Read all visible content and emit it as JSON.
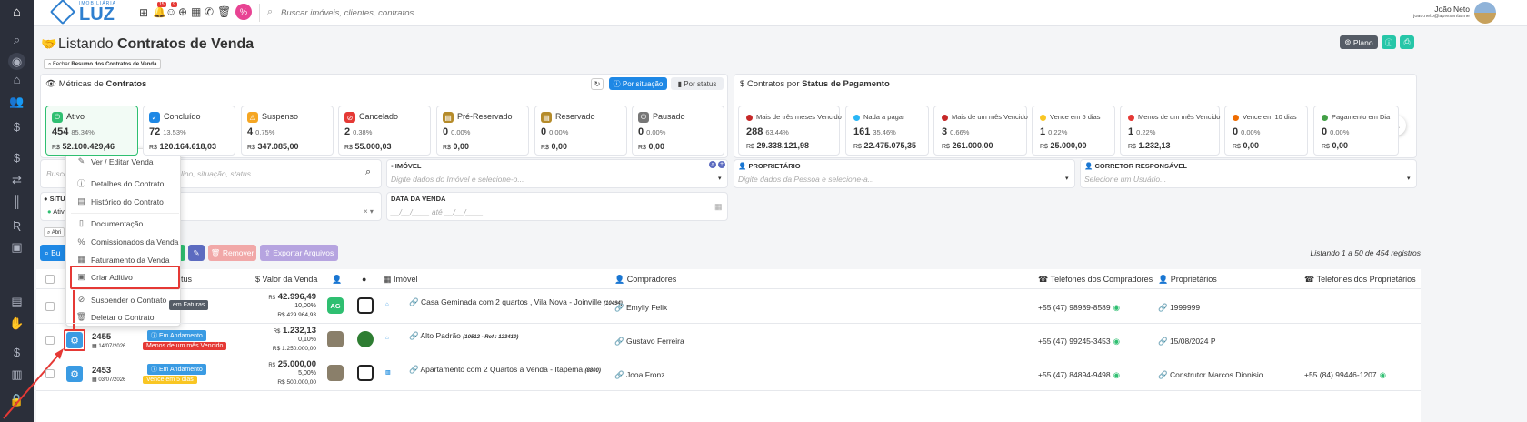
{
  "topbar": {
    "logo_small": "IMOBILIÁRIA",
    "logo": "LUZ",
    "notif_badge": "15",
    "notif_badge2": "9",
    "search_placeholder": "Buscar imóveis, clientes, contratos...",
    "user_name": "João Neto",
    "user_email": "joao.neto@apresenta.me"
  },
  "page": {
    "title_prefix": "Listando",
    "title_bold": "Contratos de Venda",
    "summary_toggle": "Fechar",
    "summary_toggle_bold": "Resumo dos Contratos de Venda",
    "plan_label": "Plano"
  },
  "metrics": {
    "title_prefix": "Métricas de",
    "title_bold": "Contratos",
    "by_situation": "Por situação",
    "by_status": "Por status",
    "items": [
      {
        "label": "Ativo",
        "count": "454",
        "pct": "85.34%",
        "currency": "R$",
        "value": "52.100.429,46"
      },
      {
        "label": "Concluído",
        "count": "72",
        "pct": "13.53%",
        "currency": "R$",
        "value": "120.164.618,03"
      },
      {
        "label": "Suspenso",
        "count": "4",
        "pct": "0.75%",
        "currency": "R$",
        "value": "347.085,00"
      },
      {
        "label": "Cancelado",
        "count": "2",
        "pct": "0.38%",
        "currency": "R$",
        "value": "55.000,03"
      },
      {
        "label": "Pré-Reservado",
        "count": "0",
        "pct": "0.00%",
        "currency": "R$",
        "value": "0,00"
      },
      {
        "label": "Reservado",
        "count": "0",
        "pct": "0.00%",
        "currency": "R$",
        "value": "0,00"
      },
      {
        "label": "Pausado",
        "count": "0",
        "pct": "0.00%",
        "currency": "R$",
        "value": "0,00"
      }
    ]
  },
  "payment": {
    "title_prefix": "Contratos por",
    "title_bold": "Status de Pagamento",
    "items": [
      {
        "label": "Mais de três meses Vencido",
        "count": "288",
        "pct": "63.44%",
        "currency": "R$",
        "value": "29.338.121,98",
        "color": "#c62828"
      },
      {
        "label": "Nada a pagar",
        "count": "161",
        "pct": "35.46%",
        "currency": "R$",
        "value": "22.475.075,35",
        "color": "#29b6f6"
      },
      {
        "label": "Mais de um mês Vencido",
        "count": "3",
        "pct": "0.66%",
        "currency": "R$",
        "value": "261.000,00",
        "color": "#c62828"
      },
      {
        "label": "Vence em 5 dias",
        "count": "1",
        "pct": "0.22%",
        "currency": "R$",
        "value": "25.000,00",
        "color": "#f9c623"
      },
      {
        "label": "Menos de um mês Vencido",
        "count": "1",
        "pct": "0.22%",
        "currency": "R$",
        "value": "1.232,13",
        "color": "#e53935"
      },
      {
        "label": "Vence em 10 dias",
        "count": "0",
        "pct": "0.00%",
        "currency": "R$",
        "value": "0,00",
        "color": "#ef6c00"
      },
      {
        "label": "Pagamento em Dia",
        "count": "0",
        "pct": "0.00%",
        "currency": "R$",
        "value": "0,00",
        "color": "#43a047"
      }
    ]
  },
  "filters": {
    "search_placeholder_left": "Busco",
    "search_placeholder_right": "lino, situação, status...",
    "imovel_label": "IMÓVEL",
    "imovel_placeholder": "Digite dados do Imóvel e selecione-o...",
    "proprietario_label": "PROPRIETÁRIO",
    "proprietario_placeholder": "Digite dados da Pessoa e selecione-a...",
    "corretor_label": "CORRETOR RESPONSÁVEL",
    "corretor_placeholder": "Selecione um Usuário...",
    "situacao_label": "SITU",
    "situacao_value": "Ativ",
    "data_label": "DATA DA VENDA",
    "data_placeholder": "__/__/____ até __/__/____",
    "advanced": "Abri"
  },
  "toolbar": {
    "search_btn": "Bu",
    "remove_btn": "Remover",
    "export_btn": "Exportar Arquivos",
    "listing": "Listando 1 a 50 de 454 registros"
  },
  "table": {
    "headers": {
      "status": "tus",
      "value": "Valor da Venda",
      "imovel": "Imóvel",
      "compradores": "Compradores",
      "tel_compradores": "Telefones dos Compradores",
      "proprietarios": "Proprietários",
      "tel_proprietarios": "Telefones dos Proprietários"
    },
    "rows": [
      {
        "id": "",
        "date": "",
        "badge1": "em Faturas",
        "badge2": "",
        "value": "42.996,49",
        "pct": "10,00%",
        "total": "R$ 429.964,93",
        "avatar": "AG",
        "imovel": "Casa Geminada com 2 quartos , Vila Nova - Joinville",
        "ref": "(10494)",
        "comprador": "Emylly Felix",
        "tel_comprador": "+55 (47) 98989-8589",
        "proprietario": "1999999",
        "tel_proprietario": ""
      },
      {
        "id": "2455",
        "date": "14/07/2026",
        "badge1": "Em Andamento",
        "badge2": "Menos de um mês Vencido",
        "value": "1.232,13",
        "pct": "0,10%",
        "total": "R$ 1.250.000,00",
        "avatar": "",
        "imovel": "Alto Padrão",
        "ref": "(10512 - Ref.: 123410)",
        "comprador": "Gustavo Ferreira",
        "tel_comprador": "+55 (47) 99245-3453",
        "proprietario": "15/08/2024 P",
        "tel_proprietario": ""
      },
      {
        "id": "2453",
        "date": "03/07/2026",
        "badge1": "Em Andamento",
        "badge2": "Vence em 5 dias",
        "value": "25.000,00",
        "pct": "5,00%",
        "total": "R$ 500.000,00",
        "avatar": "",
        "imovel": "Apartamento com 2 Quartos à Venda - Itapema",
        "ref": "(8800)",
        "comprador": "Jooa Fronz",
        "tel_comprador": "+55 (47) 84894-9498",
        "proprietario": "Construtor Marcos Dionisio",
        "tel_proprietario": "+55 (84) 99446-1207"
      }
    ],
    "currency": "R$"
  },
  "context_menu": {
    "items": [
      {
        "label": "Ver / Editar Venda",
        "icon": "edit-icon"
      },
      {
        "label": "Detalhes do Contrato",
        "icon": "info-icon"
      },
      {
        "label": "Histórico do Contrato",
        "icon": "history-icon"
      },
      {
        "label": "Documentação",
        "icon": "document-icon"
      },
      {
        "label": "Comissionados da Venda",
        "icon": "percent-icon"
      },
      {
        "label": "Faturamento da Venda",
        "icon": "invoice-icon"
      },
      {
        "label": "Criar Aditivo",
        "icon": "addendum-icon"
      },
      {
        "label": "Suspender o Contrato",
        "icon": "suspend-icon"
      },
      {
        "label": "Deletar o Contrato",
        "icon": "trash-icon"
      }
    ]
  },
  "colors": {
    "primary": "#1e88e5",
    "sidebar": "#2b2f3a",
    "highlight": "#e53935",
    "success": "#2fbf71"
  }
}
